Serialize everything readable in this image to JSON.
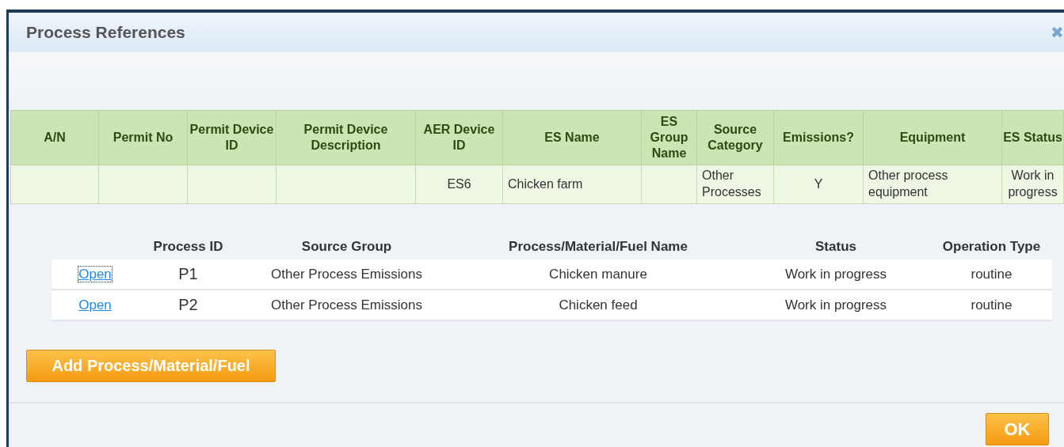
{
  "dialog": {
    "title": "Process References",
    "close_icon": "✖"
  },
  "emission_sources": {
    "columns": [
      "A/N",
      "Permit No",
      "Permit Device ID",
      "Permit Device Description",
      "AER Device ID",
      "ES Name",
      "ES Group Name",
      "Source Category",
      "Emissions?",
      "Equipment",
      "ES Status"
    ],
    "rows": [
      [
        "",
        "",
        "",
        "",
        "ES6",
        "Chicken farm",
        "",
        "Other Processes",
        "Y",
        "Other process equipment",
        "Work in progress"
      ]
    ]
  },
  "processes": {
    "columns": [
      "Process ID",
      "Source Group",
      "Process/Material/Fuel Name",
      "Status",
      "Operation Type"
    ],
    "rows": [
      {
        "link": "Open",
        "focused": true,
        "cells": [
          "P1",
          "Other Process Emissions",
          "Chicken manure",
          "Work in progress",
          "routine"
        ]
      },
      {
        "link": "Open",
        "focused": false,
        "cells": [
          "P2",
          "Other Process Emissions",
          "Chicken feed",
          "Work in progress",
          "routine"
        ]
      }
    ]
  },
  "add_button": "Add Process/Material/Fuel",
  "ok_button": "OK"
}
